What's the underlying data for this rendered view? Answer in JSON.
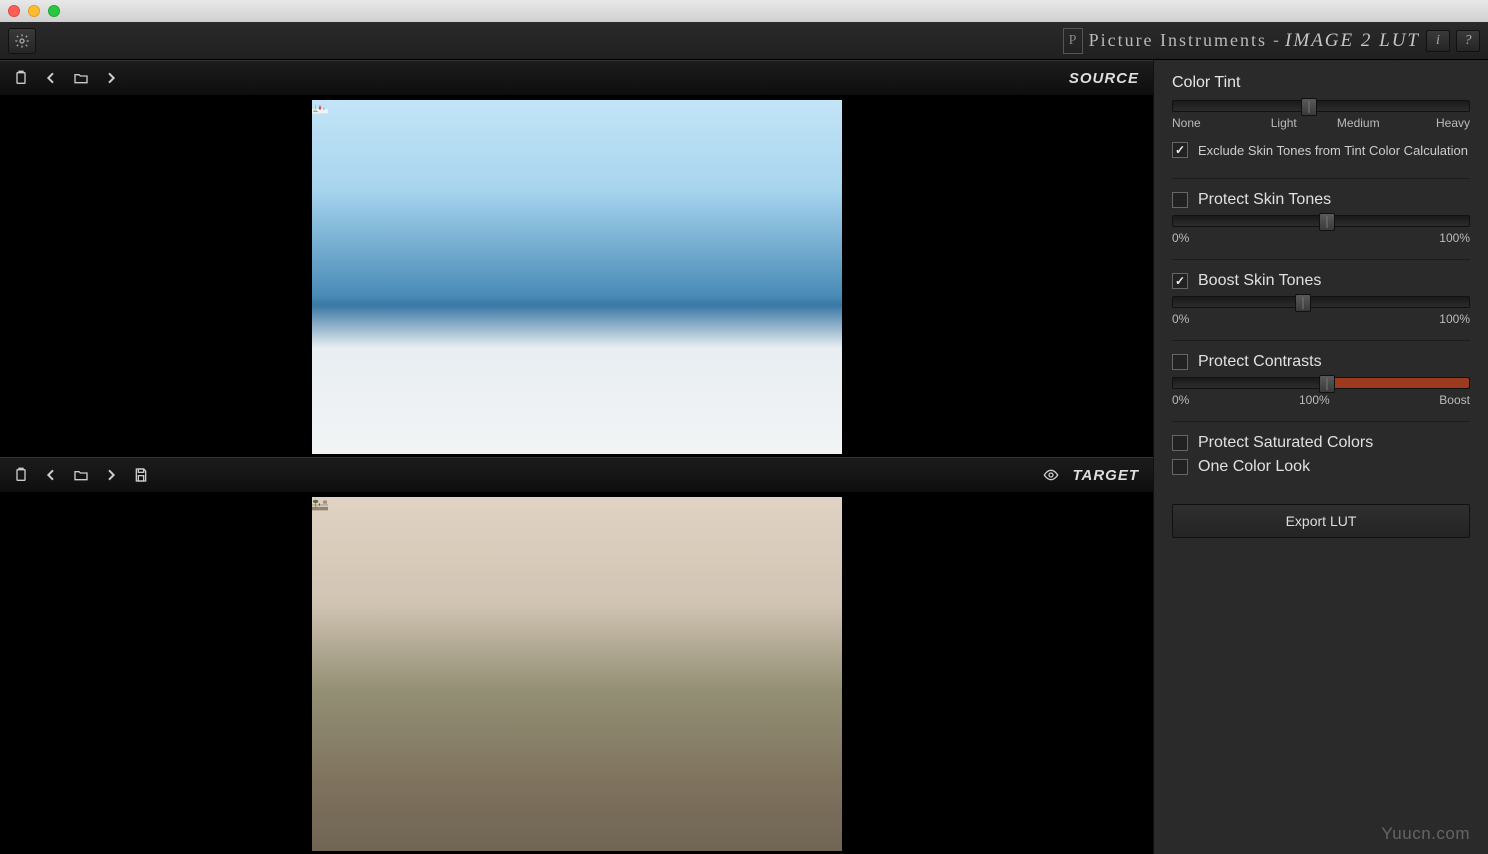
{
  "brand": {
    "company": "Picture Instruments",
    "sep": "-",
    "app": "image 2 lut",
    "logo_letter": "P"
  },
  "topbar": {
    "info": "i",
    "help": "?"
  },
  "viewers": {
    "source": "SOURCE",
    "target": "TARGET"
  },
  "panel": {
    "color_tint": {
      "title": "Color Tint",
      "labels": {
        "none": "None",
        "light": "Light",
        "medium": "Medium",
        "heavy": "Heavy"
      },
      "value_pct": 46,
      "exclude_skin": {
        "checked": true,
        "label": "Exclude Skin Tones from Tint Color Calculation"
      }
    },
    "protect_skin": {
      "checked": false,
      "label": "Protect Skin Tones",
      "min": "0%",
      "max": "100%",
      "value_pct": 52
    },
    "boost_skin": {
      "checked": true,
      "label": "Boost Skin Tones",
      "min": "0%",
      "max": "100%",
      "value_pct": 44
    },
    "protect_contrasts": {
      "checked": false,
      "label": "Protect Contrasts",
      "min": "0%",
      "mid": "100%",
      "max": "Boost",
      "value_pct": 52
    },
    "protect_saturated": {
      "checked": false,
      "label": "Protect Saturated Colors"
    },
    "one_color_look": {
      "checked": false,
      "label": "One Color Look"
    },
    "export": "Export LUT"
  },
  "watermark": "Yuucn.com"
}
